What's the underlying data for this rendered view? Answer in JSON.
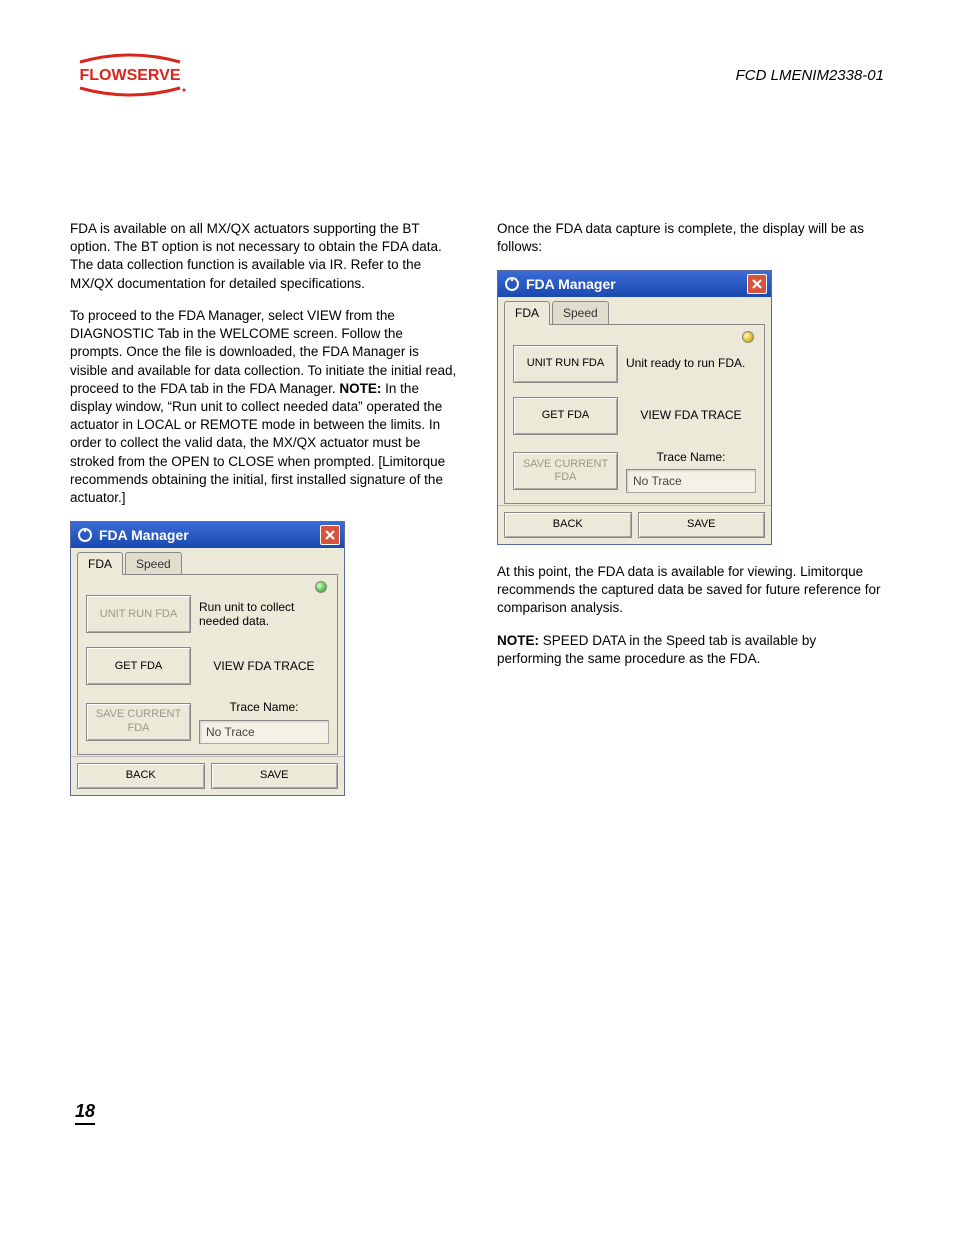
{
  "doc_id": "FCD LMENIM2338-01",
  "page_number": "18",
  "paragraphs": {
    "p1": "FDA is available on all MX/QX actuators supporting the BT option. The BT option is not necessary to obtain the FDA data. The data collection function is available via IR. Refer to the MX/QX documentation for detailed specifications.",
    "p2a": "To proceed to the FDA Manager, select VIEW from the DIAGNOSTIC Tab in the WELCOME screen. Follow the prompts. Once the file is downloaded, the FDA Manager is visible and available for data collection. To initiate the initial read, proceed to the FDA tab in the FDA Manager. ",
    "p2_note": "NOTE:",
    "p2b": " In the display window, “Run unit to collect needed data” operated the actuator in LOCAL or REMOTE mode in between the limits. In order to collect the valid data, the MX/QX actuator must be stroked from the OPEN to CLOSE when prompted. [Limitorque recommends obtaining the initial, first installed signature of the actuator.]",
    "p3": "Once the FDA data capture is complete, the display will be as follows:",
    "p4": "At this point, the FDA data is available for viewing. Limitorque recommends the captured data be saved for future reference for comparison analysis.",
    "p5_note": "NOTE:",
    "p5": " SPEED DATA in the Speed tab is available by performing the same procedure as the FDA."
  },
  "window1": {
    "title": "FDA Manager",
    "tabs": {
      "fda": "FDA",
      "speed": "Speed"
    },
    "unit_run": "UNIT RUN FDA",
    "status_msg": "Run unit to collect needed data.",
    "get_fda": "GET FDA",
    "view_trace": "VIEW FDA TRACE",
    "save_current": "SAVE CURRENT FDA",
    "trace_label": "Trace Name:",
    "trace_value": "No Trace",
    "back": "BACK",
    "save": "SAVE",
    "unit_run_enabled": false,
    "save_current_enabled": false
  },
  "window2": {
    "title": "FDA Manager",
    "tabs": {
      "fda": "FDA",
      "speed": "Speed"
    },
    "unit_run": "UNIT RUN FDA",
    "status_msg": "Unit ready to run FDA.",
    "get_fda": "GET FDA",
    "view_trace": "VIEW FDA TRACE",
    "save_current": "SAVE CURRENT FDA",
    "trace_label": "Trace Name:",
    "trace_value": "No Trace",
    "back": "BACK",
    "save": "SAVE",
    "unit_run_enabled": true,
    "save_current_enabled": false
  }
}
